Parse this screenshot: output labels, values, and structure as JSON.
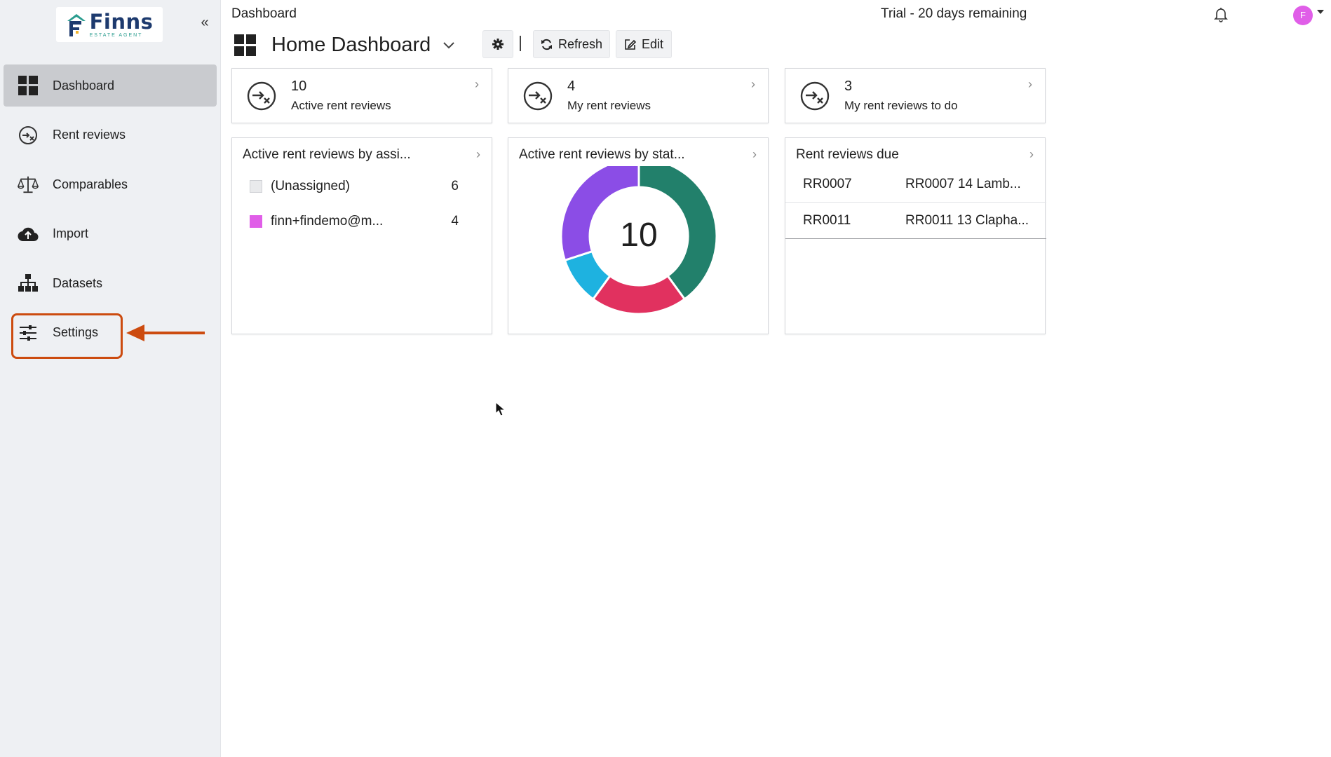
{
  "sidebar": {
    "logo": {
      "name": "Finns",
      "sub": "ESTATE AGENT"
    },
    "collapse_label": "«",
    "items": [
      {
        "label": "Dashboard"
      },
      {
        "label": "Rent reviews"
      },
      {
        "label": "Comparables"
      },
      {
        "label": "Import"
      },
      {
        "label": "Datasets"
      },
      {
        "label": "Settings"
      }
    ]
  },
  "header": {
    "breadcrumb": "Dashboard",
    "trial": "Trial - 20 days remaining",
    "avatar_initial": "F"
  },
  "dashboard": {
    "title": "Home Dashboard",
    "refresh_label": "Refresh",
    "edit_label": "Edit"
  },
  "stats": [
    {
      "value": "10",
      "label": "Active rent reviews"
    },
    {
      "value": "4",
      "label": "My rent reviews"
    },
    {
      "value": "3",
      "label": "My rent reviews to do"
    }
  ],
  "panels": {
    "assignee": {
      "title": "Active rent reviews by assi...",
      "rows": [
        {
          "name": "(Unassigned)",
          "count": "6",
          "color": "#e9eaec"
        },
        {
          "name": "finn+findemo@m...",
          "count": "4",
          "color": "#e05ee8"
        }
      ]
    },
    "status": {
      "title": "Active rent reviews by stat...",
      "total": "10"
    },
    "due": {
      "title": "Rent reviews due",
      "rows": [
        {
          "code": "RR0007",
          "desc": "RR0007 14 Lamb..."
        },
        {
          "code": "RR0011",
          "desc": "RR0011 13 Clapha..."
        }
      ]
    }
  },
  "chart_data": {
    "type": "pie",
    "title": "Active rent reviews by stat...",
    "center_label": "10",
    "slices": [
      {
        "value": 4,
        "color": "#22806b"
      },
      {
        "value": 2,
        "color": "#e1315f"
      },
      {
        "value": 1,
        "color": "#1eb2e0"
      },
      {
        "value": 3,
        "color": "#8b4de6"
      }
    ]
  },
  "colors": {
    "accent_highlight": "#cc4b0f",
    "active_nav": "#c9cbcf"
  }
}
